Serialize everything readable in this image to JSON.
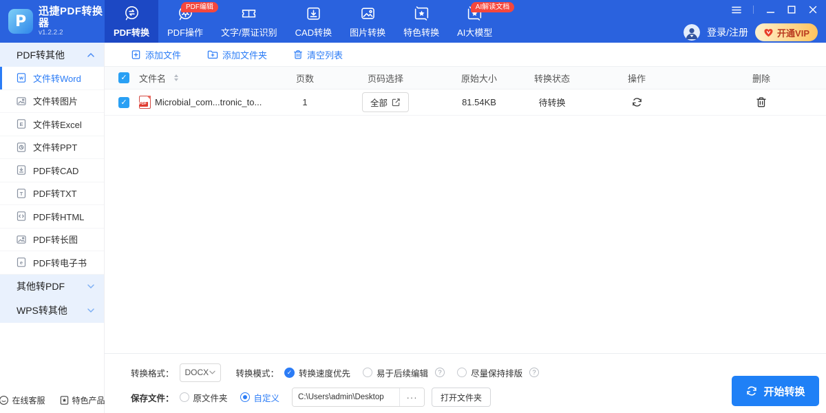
{
  "app": {
    "title": "迅捷PDF转换器",
    "version": "v1.2.2.2"
  },
  "colors": {
    "header_blue": "#2a62de",
    "active_tab_blue": "#1c48c4",
    "accent_blue": "#2b7cf6",
    "checkbox_blue": "#2aa0f4",
    "badge_red": "#f5473d",
    "vip_gradient": [
      "#fdf0cd",
      "#ffc35e"
    ],
    "vip_text": "#b93a20",
    "start_button_blue": "#1f80f6"
  },
  "header": {
    "tabs": [
      {
        "label": "PDF转换",
        "active": true
      },
      {
        "label": "PDF操作",
        "badge": "PDF编辑"
      },
      {
        "label": "文字/票证识别"
      },
      {
        "label": "CAD转换"
      },
      {
        "label": "图片转换"
      },
      {
        "label": "特色转换"
      },
      {
        "label": "AI大模型",
        "badge": "AI解读文档"
      }
    ],
    "login_label": "登录/注册",
    "vip_label": "开通VIP"
  },
  "sidebar": {
    "groups": [
      {
        "label": "PDF转其他",
        "expanded": true
      },
      {
        "label": "其他转PDF",
        "expanded": false
      },
      {
        "label": "WPS转其他",
        "expanded": false
      }
    ],
    "items": [
      {
        "label": "文件转Word",
        "active": true,
        "glyph": "w"
      },
      {
        "label": "文件转图片"
      },
      {
        "label": "文件转Excel",
        "glyph": "E"
      },
      {
        "label": "文件转PPT"
      },
      {
        "label": "PDF转CAD"
      },
      {
        "label": "PDF转TXT",
        "glyph": "T"
      },
      {
        "label": "PDF转HTML",
        "glyph": "/"
      },
      {
        "label": "PDF转长图"
      },
      {
        "label": "PDF转电子书",
        "glyph": "e"
      }
    ],
    "footer": {
      "service": "在线客服",
      "products": "特色产品"
    }
  },
  "toolbar": {
    "add_file": "添加文件",
    "add_folder": "添加文件夹",
    "clear_list": "清空列表"
  },
  "table": {
    "headers": {
      "file_name": "文件名",
      "pages": "页数",
      "page_select": "页码选择",
      "size": "原始大小",
      "status": "转换状态",
      "action": "操作",
      "delete": "删除"
    },
    "rows": [
      {
        "name": "Microbial_com...tronic_to...",
        "pages": "1",
        "page_select": "全部",
        "size": "81.54KB",
        "status": "待转换"
      }
    ]
  },
  "settings": {
    "format_label": "转换格式：",
    "format_value": "DOCX",
    "mode_label": "转换模式：",
    "modes": [
      {
        "label": "转换速度优先",
        "selected": true
      },
      {
        "label": "易于后续编辑",
        "help": true
      },
      {
        "label": "尽量保持排版",
        "help": true
      }
    ],
    "save_label": "保存文件：",
    "save_options": [
      {
        "label": "原文件夹",
        "selected": false
      },
      {
        "label": "自定义",
        "selected": true
      }
    ],
    "path_value": "C:\\Users\\admin\\Desktop",
    "more_label": "···",
    "open_folder_label": "打开文件夹",
    "start_label": "开始转换"
  }
}
